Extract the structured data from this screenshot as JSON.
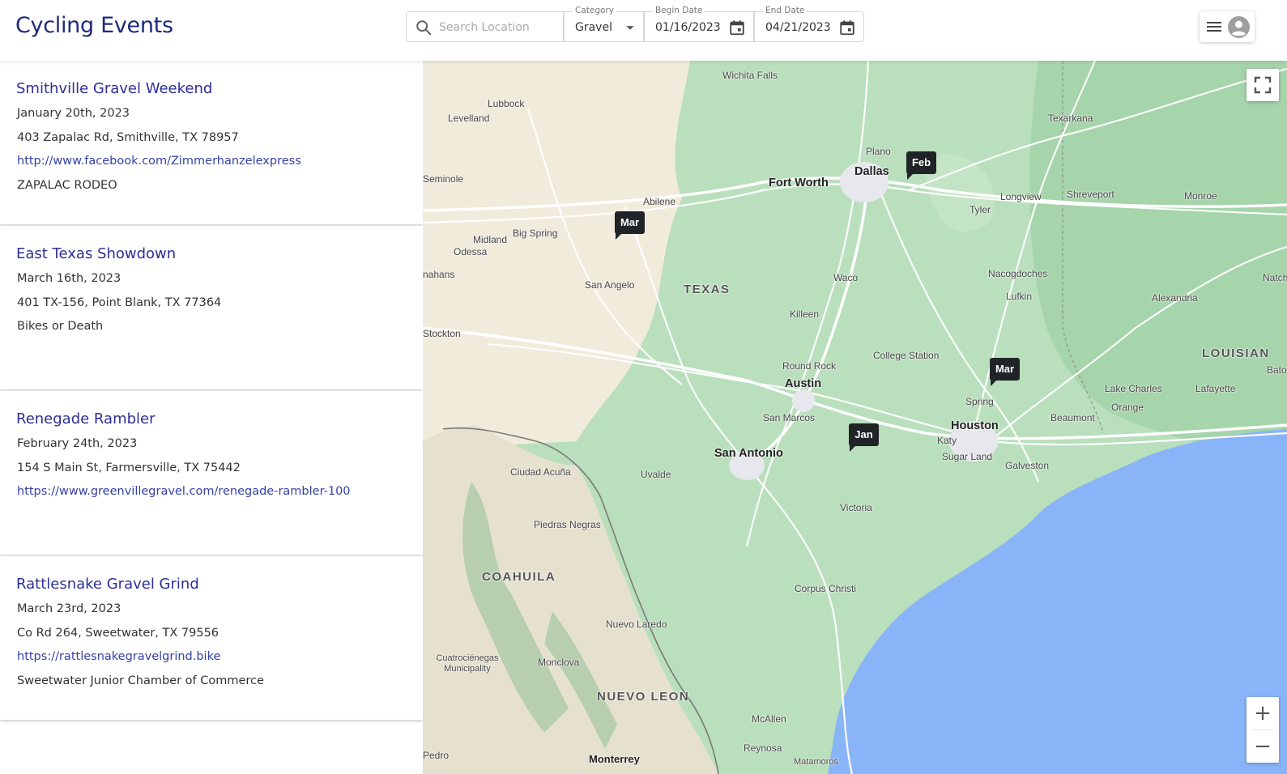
{
  "header": {
    "title": "Cycling Events",
    "search": {
      "placeholder": "Search Location",
      "icon": "search-icon"
    },
    "category": {
      "label": "Category",
      "value": "Gravel",
      "icon": "dropdown-arrow-icon"
    },
    "begin_date": {
      "label": "Begin Date",
      "value": "01/16/2023",
      "icon": "calendar-icon"
    },
    "end_date": {
      "label": "End Date",
      "value": "04/21/2023",
      "icon": "calendar-icon"
    },
    "menu": {
      "icons": [
        "hamburger-menu-icon",
        "account-circle-icon"
      ]
    }
  },
  "events": [
    {
      "title": "Smithville Gravel Weekend",
      "date": "January 20th, 2023",
      "address": "403 Zapalac Rd, Smithville, TX 78957",
      "link": "http://www.facebook.com/Zimmerhanzelexpress",
      "organizer": "ZAPALAC RODEO"
    },
    {
      "title": "East Texas Showdown",
      "date": "March 16th, 2023",
      "address": "401 TX-156, Point Blank, TX 77364",
      "organizer": "Bikes or Death"
    },
    {
      "title": "Renegade Rambler",
      "date": "February 24th, 2023",
      "address": "154 S Main St, Farmersville, TX 75442",
      "link": "https://www.greenvillegravel.com/renegade-rambler-100"
    },
    {
      "title": "Rattlesnake Gravel Grind",
      "date": "March 23rd, 2023",
      "address": "Co Rd 264, Sweetwater, TX 79556",
      "link": "https://rattlesnakegravelgrind.bike",
      "organizer": "Sweetwater Junior Chamber of Commerce"
    }
  ],
  "map": {
    "markers": [
      "Feb",
      "Mar",
      "Mar",
      "Jan"
    ],
    "regions": [
      "TEXAS",
      "COAHUILA",
      "NUEVO LEON",
      "LOUISIAN"
    ],
    "major_cities": [
      "Dallas",
      "Fort Worth",
      "Austin",
      "San Antonio",
      "Houston"
    ],
    "cities": [
      "Wichita Falls",
      "Lubbock",
      "Levelland",
      "Plano",
      "Texarkana",
      "Seminole",
      "Abilene",
      "Longview",
      "Shreveport",
      "Monroe",
      "Tyler",
      "Midland",
      "Big Spring",
      "Odessa",
      "nahans",
      "San Angelo",
      "Waco",
      "Nacogdoches",
      "Natch",
      "Killeen",
      "Lufkin",
      "Alexandria",
      "Stockton",
      "College Station",
      "Round Rock",
      "Bato",
      "Lake Charles",
      "Lafayette",
      "Spring",
      "Beaumont",
      "Orange",
      "San Marcos",
      "Katy",
      "Sugar Land",
      "Galveston",
      "Ciudad Acuña",
      "Uvalde",
      "Piedras Negras",
      "Victoria",
      "Corpus Christi",
      "Nuevo Laredo",
      "Cuatrociénegas Municipality",
      "Monclova",
      "McAllen",
      "Reynosa",
      "Pedro",
      "Monterrey",
      "Matamoros"
    ],
    "fullscreen_icon": "fullscreen-icon",
    "zoom_in_label": "+",
    "zoom_out_label": "−",
    "colors": {
      "land_green": "#b5dcb8",
      "desert": "#f1ebdc",
      "water": "#8ab4f8",
      "marker": "#202427"
    }
  }
}
